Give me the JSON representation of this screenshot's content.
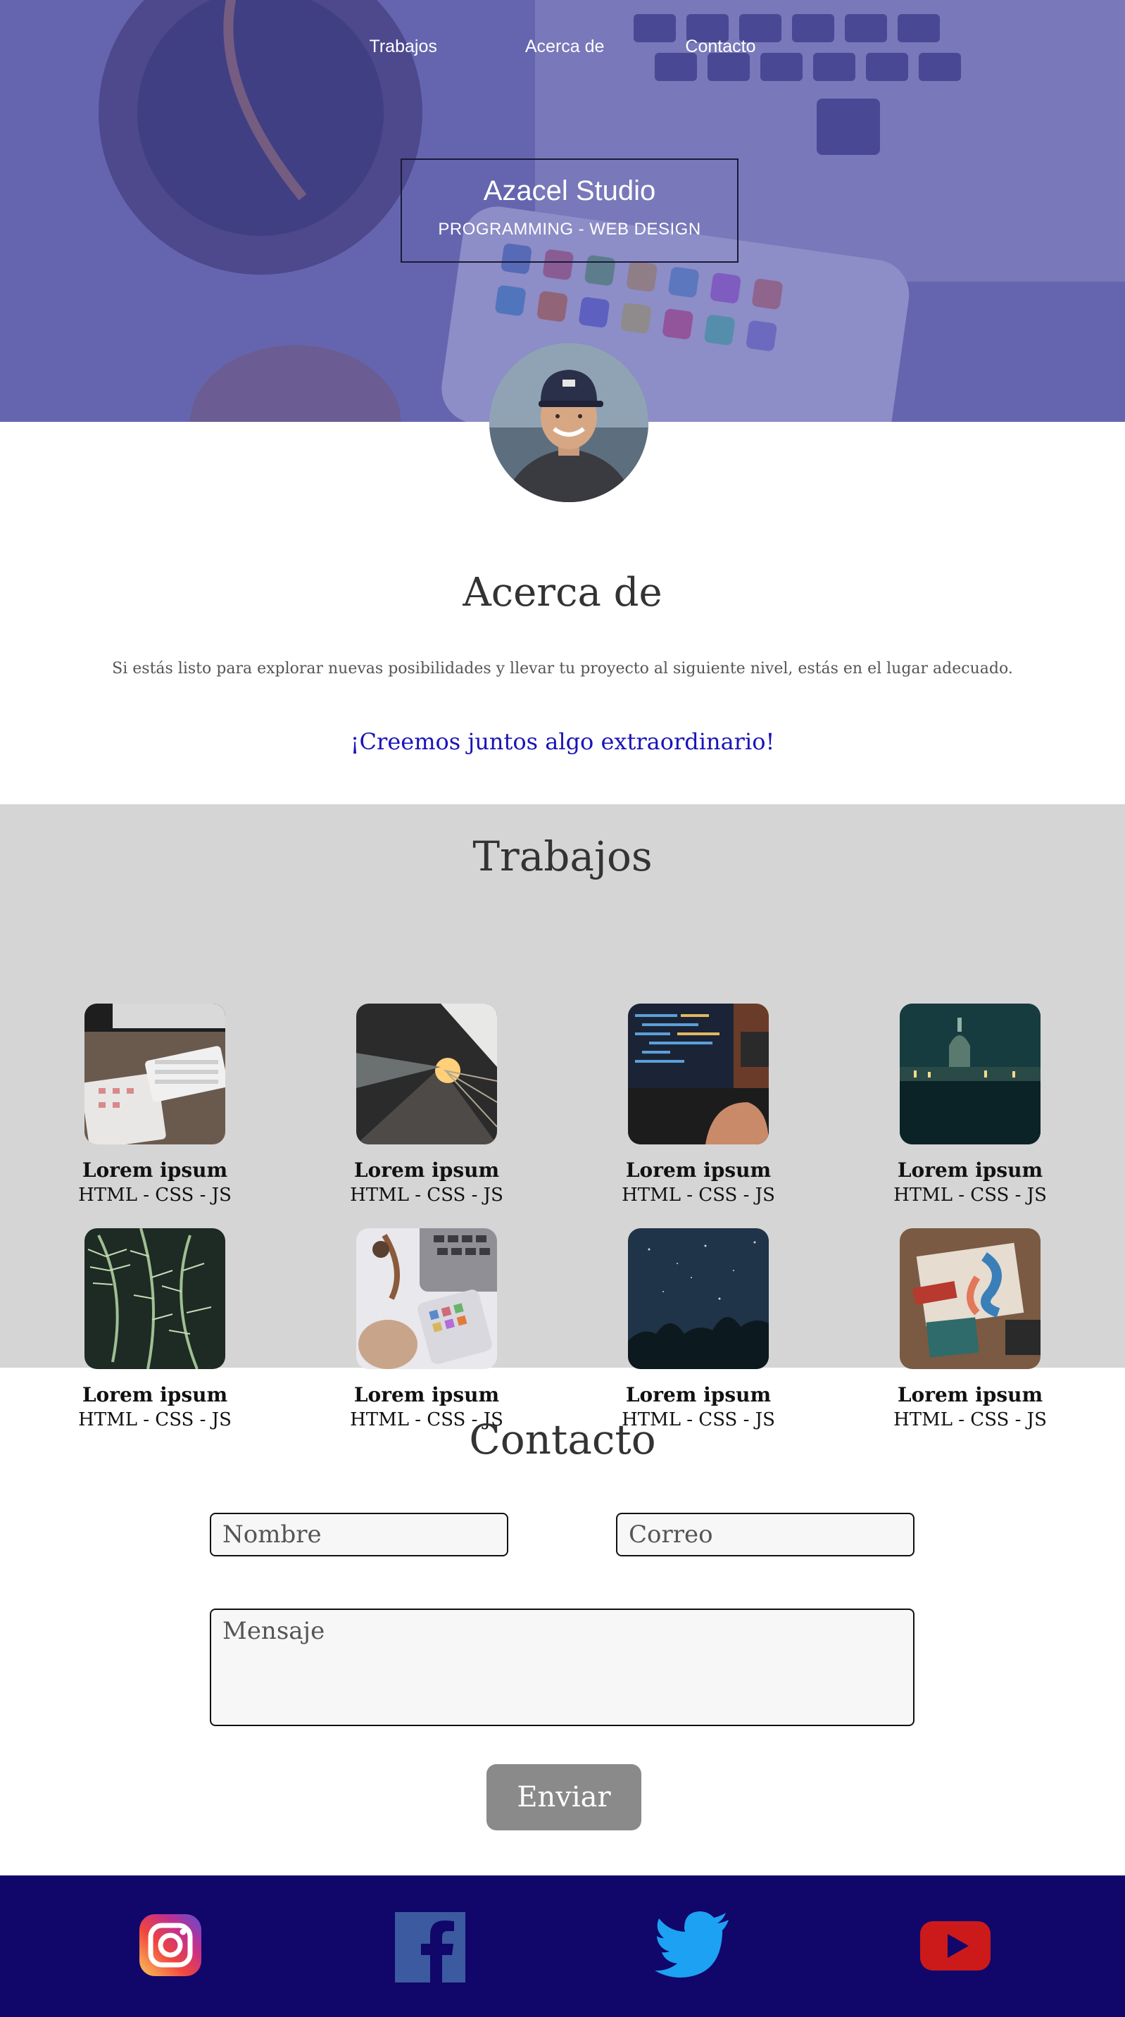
{
  "nav": {
    "items": [
      "Trabajos",
      "Acerca de",
      "Contacto"
    ]
  },
  "brand": {
    "title": "Azacel Studio",
    "subtitle": "PROGRAMMING - WEB DESIGN"
  },
  "about": {
    "title": "Acerca de",
    "text": "Si estás listo para explorar nuevas posibilidades y llevar tu proyecto al siguiente nivel, estás en el lugar adecuado.",
    "cta": "¡Creemos juntos algo extraordinario!"
  },
  "works": {
    "title": "Trabajos",
    "items": [
      {
        "name": "Lorem ipsum",
        "tags": "HTML - CSS - JS",
        "image": "desk-computer"
      },
      {
        "name": "Lorem ipsum",
        "tags": "HTML - CSS - JS",
        "image": "train-platform"
      },
      {
        "name": "Lorem ipsum",
        "tags": "HTML - CSS - JS",
        "image": "laptop-code"
      },
      {
        "name": "Lorem ipsum",
        "tags": "HTML - CSS - JS",
        "image": "city-night"
      },
      {
        "name": "Lorem ipsum",
        "tags": "HTML - CSS - JS",
        "image": "fern-leaves"
      },
      {
        "name": "Lorem ipsum",
        "tags": "HTML - CSS - JS",
        "image": "laptop-phone"
      },
      {
        "name": "Lorem ipsum",
        "tags": "HTML - CSS - JS",
        "image": "night-sky"
      },
      {
        "name": "Lorem ipsum",
        "tags": "HTML - CSS - JS",
        "image": "design-desk"
      }
    ]
  },
  "contact": {
    "title": "Contacto",
    "name_placeholder": "Nombre",
    "email_placeholder": "Correo",
    "message_placeholder": "Mensaje",
    "send_label": "Enviar"
  },
  "footer": {
    "social": [
      "instagram-icon",
      "facebook-icon",
      "twitter-icon",
      "youtube-icon"
    ]
  },
  "colors": {
    "hero_overlay": "#5250aa",
    "cta": "#1a14b8",
    "works_bg": "#d6d5d6",
    "footer_bg": "#11066a",
    "button_bg": "#8a8a8a"
  }
}
